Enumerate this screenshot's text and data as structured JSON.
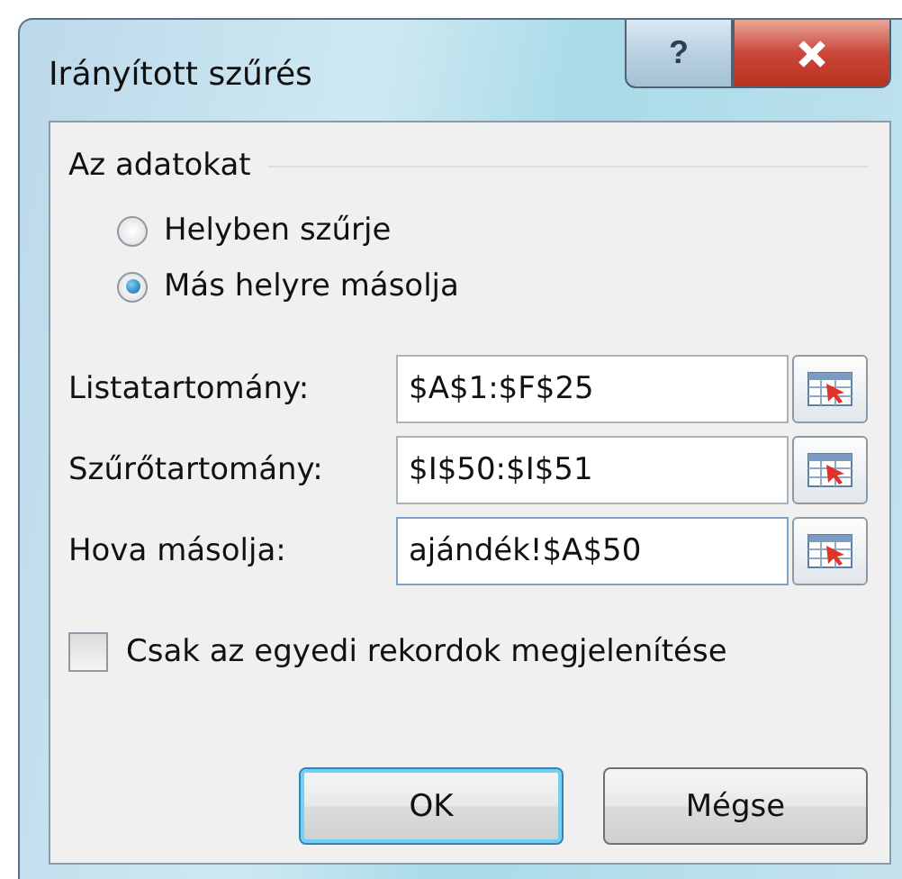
{
  "window": {
    "title": "Irányított szűrés",
    "title_buttons": [
      {
        "kind": "help",
        "label": "?"
      },
      {
        "kind": "close"
      }
    ]
  },
  "group": {
    "label": "Az adatokat",
    "options": [
      {
        "label": "Helyben szűrje",
        "selected": false
      },
      {
        "label": "Más helyre másolja",
        "selected": true
      }
    ]
  },
  "fields": [
    {
      "label": "Listatartomány:",
      "value": "$A$1:$F$25",
      "focused": false
    },
    {
      "label": "Szűrőtartomány:",
      "value": "$I$50:$I$51",
      "focused": false
    },
    {
      "label": "Hova másolja:",
      "value": "ajándék!$A$50",
      "focused": true
    }
  ],
  "unique_only": {
    "label": "Csak az egyedi rekordok megjelenítése",
    "checked": false
  },
  "buttons": [
    {
      "label": "OK",
      "default": true
    },
    {
      "label": "Mégse",
      "default": false
    }
  ]
}
